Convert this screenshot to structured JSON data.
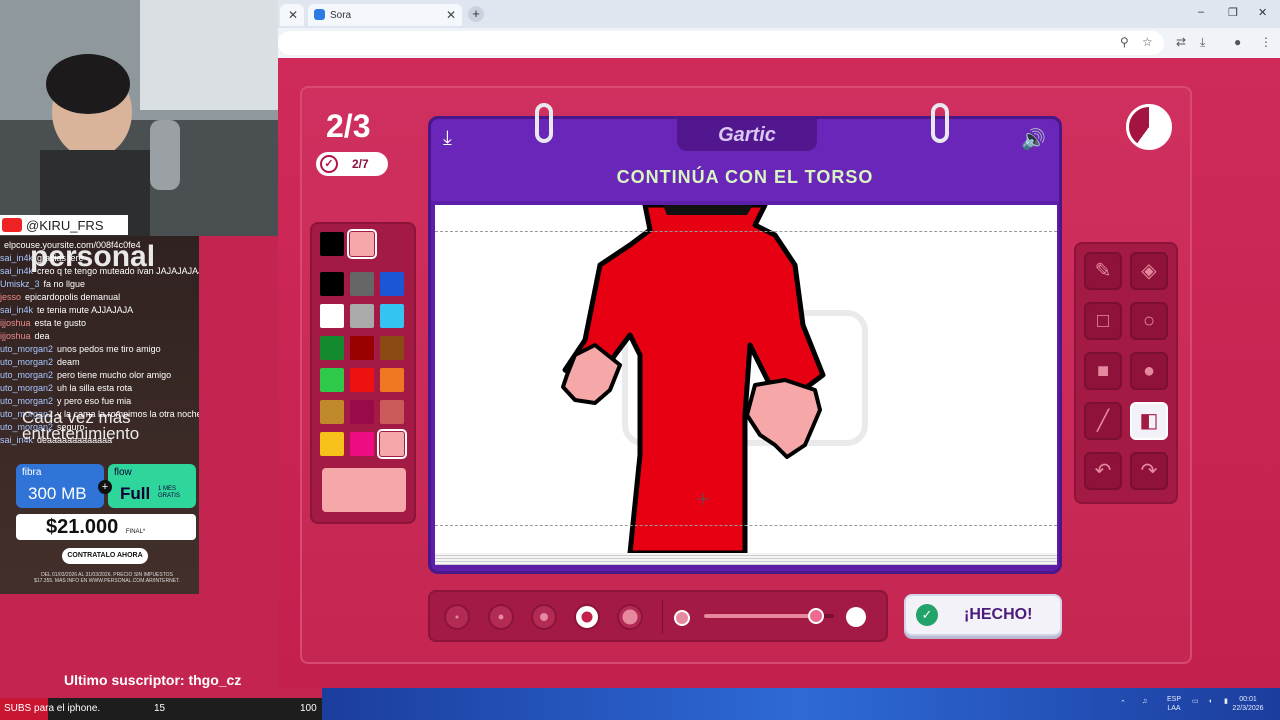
{
  "browser": {
    "tabs": [
      {
        "label": ""
      },
      {
        "label": "Sora"
      }
    ],
    "new_tab": "+",
    "window_controls": {
      "minimize": "–",
      "restore": "❐",
      "close": "✕"
    }
  },
  "game": {
    "round": "2/3",
    "progress": "2/7",
    "logo": "Gartic",
    "instruction": "CONTINÚA CON EL TORSO",
    "timer_remaining_fraction": 0.6,
    "palette": {
      "current": [
        "#000000",
        "#f6a8a8"
      ],
      "colors": [
        "#000000",
        "#666666",
        "#1a56d6",
        "#ffffff",
        "#aaaaaa",
        "#35c4f2",
        "#138a2e",
        "#990000",
        "#8a4a12",
        "#2fc94a",
        "#ee1111",
        "#f07822",
        "#c08a2a",
        "#990a4a",
        "#cc5a5a",
        "#f6c21a",
        "#ee0c82",
        "#f6a8a8"
      ],
      "selected_index": 17,
      "big_preview": "#f6a8a8"
    },
    "tools": [
      "pencil-icon",
      "eraser-icon",
      "rect-outline-icon",
      "circle-outline-icon",
      "rect-fill-icon",
      "circle-fill-icon",
      "line-icon",
      "fill-bucket-icon",
      "undo-icon",
      "redo-icon"
    ],
    "active_tool": "fill-bucket-icon",
    "brush_sizes": 5,
    "selected_brush_index": 3,
    "opacity_fraction": 0.86,
    "done_label": "¡HECHO!",
    "accent": "#c3204c",
    "book_color": "#5e1fa8"
  },
  "stream": {
    "channel": "@KIRU_FRS",
    "chat": [
      {
        "user": "",
        "text": "elpcouse.yoursite.com/008f4c0fe4"
      },
      {
        "user": "sai_in4k",
        "text": "gracias jere"
      },
      {
        "user": "sai_in4k",
        "text": "creo q te tengo muteado ivan JAJAJAJAJA"
      },
      {
        "user": "Umiskz_3",
        "text": "fa no llgue"
      },
      {
        "user": "jesso",
        "text": "epicardopolis demanual"
      },
      {
        "user": "sai_in4k",
        "text": "te tenia mute AJJAJAJA"
      },
      {
        "user": "ijjoshua",
        "text": "esta te gusto"
      },
      {
        "user": "ijjoshua",
        "text": "dea"
      },
      {
        "user": "uto_morgan2",
        "text": "unos pedos me tiro amigo"
      },
      {
        "user": "uto_morgan2",
        "text": "deam"
      },
      {
        "user": "uto_morgan2",
        "text": "pero tiene mucho olor amigo"
      },
      {
        "user": "uto_morgan2",
        "text": "uh la silla esta rota"
      },
      {
        "user": "uto_morgan2",
        "text": "y pero eso fue mia"
      },
      {
        "user": "uto_morgan2",
        "text": "y la cama la rompimos la otra noche bombon"
      },
      {
        "user": "uto_morgan2",
        "text": "seguro"
      },
      {
        "user": "sai_in4k",
        "text": "deaaaaaaaaaaaaa"
      }
    ],
    "ad": {
      "brand": "personal",
      "tagline": "Cada vez más entretenimiento",
      "fibra_label": "fibra",
      "fibra_speed": "300 MB",
      "flow_label": "flow",
      "flow_plan": "Full",
      "flow_note": "1 MES GRATIS",
      "plus": "+",
      "price": "$21.000",
      "price_note": "FINAL*",
      "cta": "CONTRATALO AHORA",
      "legal": "DEL 01/03/2026 AL 31/03/2026. PRECIO SIN IMPUESTOS $17.355. MAS INFO EN WWW.PERSONAL.COM.AR/INTERNET."
    },
    "last_sub": "Ultimo suscriptor: thgo_cz",
    "subs_goal": {
      "label": "SUBS para el iphone.",
      "current": "15",
      "target": "100"
    }
  },
  "taskbar": {
    "lang": "ESP",
    "region": "LAA",
    "time": "00:01",
    "date": "22/3/2026"
  }
}
